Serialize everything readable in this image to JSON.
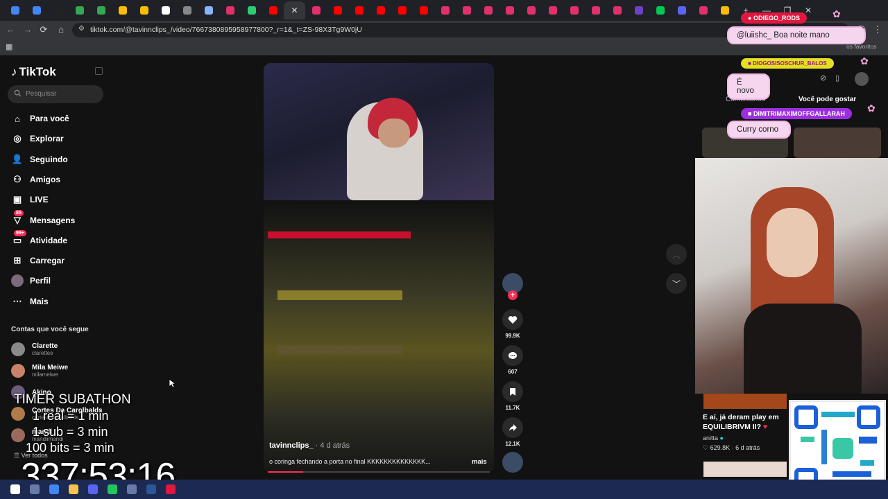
{
  "browser": {
    "tab_favicon_colors": [
      "#4285f4",
      "#4285f4",
      "#222222",
      "#34a853",
      "#34a853",
      "#fbbc04",
      "#fbbc04",
      "#ffffff",
      "#888888",
      "#8ab4f8",
      "#e1306c",
      "#2ecc71",
      "#ff0000",
      "#35363a",
      "#e1306c",
      "#ff0000",
      "#ff0000",
      "#ff0000",
      "#ff0000",
      "#ff0000",
      "#e1306c",
      "#e1306c",
      "#e1306c",
      "#e1306c",
      "#e1306c",
      "#e1306c",
      "#e1306c",
      "#e1306c",
      "#e1306c",
      "#6f42c1",
      "#00c853",
      "#5865f2",
      "#e1306c",
      "#fbbc04"
    ],
    "url": "tiktok.com/@tavinnclips_/video/7667380895958977800?_r=1&_t=ZS-98X3Tg9W0jU",
    "bookmarks_right": "os favoritos"
  },
  "tiktok": {
    "logo": "TikTok",
    "search_placeholder": "Pesquisar",
    "nav": [
      {
        "label": "Para você",
        "icon": "home-icon"
      },
      {
        "label": "Explorar",
        "icon": "compass-icon"
      },
      {
        "label": "Seguindo",
        "icon": "following-icon"
      },
      {
        "label": "Amigos",
        "icon": "friends-icon"
      },
      {
        "label": "LIVE",
        "icon": "live-icon"
      },
      {
        "label": "Mensagens",
        "icon": "messages-icon",
        "badge": "85"
      },
      {
        "label": "Atividade",
        "icon": "activity-icon",
        "badge": "99+"
      },
      {
        "label": "Carregar",
        "icon": "upload-icon"
      },
      {
        "label": "Perfil",
        "icon": "profile-icon"
      },
      {
        "label": "Mais",
        "icon": "more-icon"
      }
    ],
    "following_title": "Contas que você segue",
    "accounts": [
      {
        "name": "Clarette",
        "handle": "clarettee",
        "color": "#8a8a8a"
      },
      {
        "name": "Mila Meiwe",
        "handle": "milameiwe",
        "color": "#c9836a"
      },
      {
        "name": "Akino",
        "handle": "",
        "color": "#6a5c7a"
      },
      {
        "name": "Cortes Da Carolbalds",
        "handle": "cortesdacarolbalds",
        "color": "#b07a4a"
      },
      {
        "name": "mandi",
        "handle": "mandiimandi",
        "color": "#9a6a5a"
      }
    ],
    "see_all": "Ver todos",
    "video": {
      "username": "tavinnclips_",
      "time": " · 4 d atrás",
      "description": "o coringa fechando a porta no final KKKKKKKKKKKKKK...",
      "more": "mais",
      "progress": 0.16,
      "likes": "99.9K",
      "comments": "607",
      "saves": "11.7K",
      "shares": "12.1K"
    }
  },
  "right_panel": {
    "tab_comments": "Comentários",
    "tab_like": "Você pode gostar",
    "rec_title": "E aí, já deram play em EQUILIBRIVM II?",
    "rec_heart": " ♥",
    "rec_author": "anitta",
    "rec_likes": "629.8K",
    "rec_time": "6 d atrás"
  },
  "chat": {
    "tag1": "ODIEGO_RODS",
    "msg1": "@luiishc_ Boa noite mano",
    "tag2": "DIOGOSISOSCHUR_BALOS",
    "msg2": "É novo",
    "tag3": "DIMITRIMAXIMOFFGALLARAH",
    "msg3": "Curry corno"
  },
  "overlay": {
    "title": "TIMER SUBATHON",
    "rule1": "1 real = 1 min",
    "rule2": "1 sub = 3 min",
    "rule3": "100 bits = 3 min",
    "timer": "337:53:16"
  }
}
